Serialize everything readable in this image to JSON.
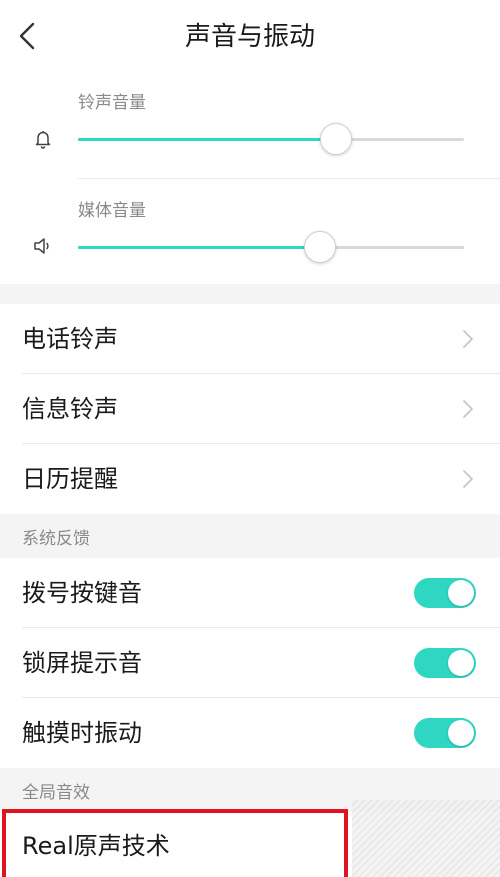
{
  "header": {
    "title": "声音与振动",
    "back_icon": "chevron-left-icon"
  },
  "volume": {
    "ringtone": {
      "label": "铃声音量",
      "icon": "bell-icon",
      "level": 0.665
    },
    "media": {
      "label": "媒体音量",
      "icon": "speaker-icon",
      "level": 0.625
    },
    "accent_color": "#2fd6c2"
  },
  "ringtones": {
    "items": [
      {
        "label": "电话铃声"
      },
      {
        "label": "信息铃声"
      },
      {
        "label": "日历提醒"
      }
    ]
  },
  "system_feedback": {
    "header": "系统反馈",
    "items": [
      {
        "label": "拨号按键音",
        "on": true
      },
      {
        "label": "锁屏提示音",
        "on": true
      },
      {
        "label": "触摸时振动",
        "on": true
      }
    ]
  },
  "global_effects": {
    "header": "全局音效",
    "items": [
      {
        "label": "Real原声技术"
      }
    ]
  },
  "highlight_color": "#e0141e"
}
